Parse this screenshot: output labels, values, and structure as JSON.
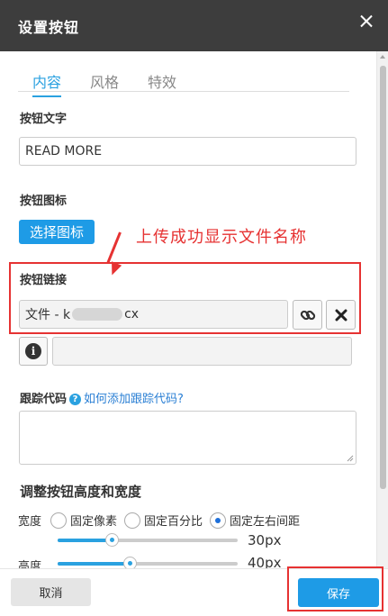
{
  "dialog": {
    "title": "设置按钮"
  },
  "tabs": [
    {
      "label": "内容",
      "active": true
    },
    {
      "label": "风格",
      "active": false
    },
    {
      "label": "特效",
      "active": false
    }
  ],
  "button_text": {
    "label": "按钮文字",
    "value": "READ MORE"
  },
  "button_icon": {
    "label": "按钮图标",
    "choose_label": "选择图标"
  },
  "annotation": {
    "text": "上传成功显示文件名称"
  },
  "button_link": {
    "label": "按钮链接",
    "value_prefix": "文件 - k",
    "value_suffix": "cx"
  },
  "tracking": {
    "label": "跟踪代码",
    "help_link": "如何添加跟踪代码?"
  },
  "size": {
    "title": "调整按钮高度和宽度",
    "width_label": "宽度",
    "width_options": [
      {
        "label": "固定像素",
        "checked": false
      },
      {
        "label": "固定百分比",
        "checked": false
      },
      {
        "label": "固定左右间距",
        "checked": true
      }
    ],
    "width_value": "30px",
    "width_level": 0.3,
    "height_label": "高度",
    "height_value": "40px",
    "height_level": 0.4
  },
  "footer": {
    "cancel_label": "取消",
    "save_label": "保存"
  },
  "colors": {
    "accent": "#1e9be6",
    "annotation_red": "#e63232",
    "header_bg": "#3d3d3d"
  },
  "icons": [
    "close-icon",
    "link-icon",
    "remove-icon",
    "info-icon",
    "help-icon",
    "resize-grip-icon"
  ]
}
